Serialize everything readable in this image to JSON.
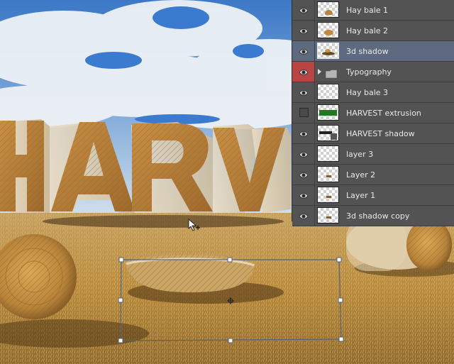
{
  "layers_panel": {
    "layers": [
      {
        "name": "Hay bale 1",
        "visible": true,
        "thumb": "hay-bale-1"
      },
      {
        "name": "Hay bale 2",
        "visible": true,
        "thumb": "hay-bale-2"
      },
      {
        "name": "3d shadow",
        "visible": true,
        "thumb": "3d-shadow",
        "selected": true
      },
      {
        "name": "Typography",
        "visible": true,
        "type": "group",
        "highlight": "#b84444"
      },
      {
        "name": "Hay bale 3",
        "visible": true,
        "thumb": "empty"
      },
      {
        "name": "HARVEST extrusion",
        "visible": false,
        "thumb": "harvest-extrusion"
      },
      {
        "name": "HARVEST shadow",
        "visible": true,
        "thumb": "harvest-shadow"
      },
      {
        "name": "layer 3",
        "visible": true,
        "thumb": "empty"
      },
      {
        "name": "Layer 2",
        "visible": true,
        "thumb": "small-mark"
      },
      {
        "name": "Layer 1",
        "visible": true,
        "thumb": "small-mark"
      },
      {
        "name": "3d shadow copy",
        "visible": true,
        "thumb": "small-mark"
      }
    ]
  },
  "canvas": {
    "artwork_text": "HARV",
    "colors": {
      "sky_top": "#2f6fc4",
      "cloud": "#eef2f6",
      "straw": "#c9963f",
      "field": "#b98a3c"
    }
  }
}
